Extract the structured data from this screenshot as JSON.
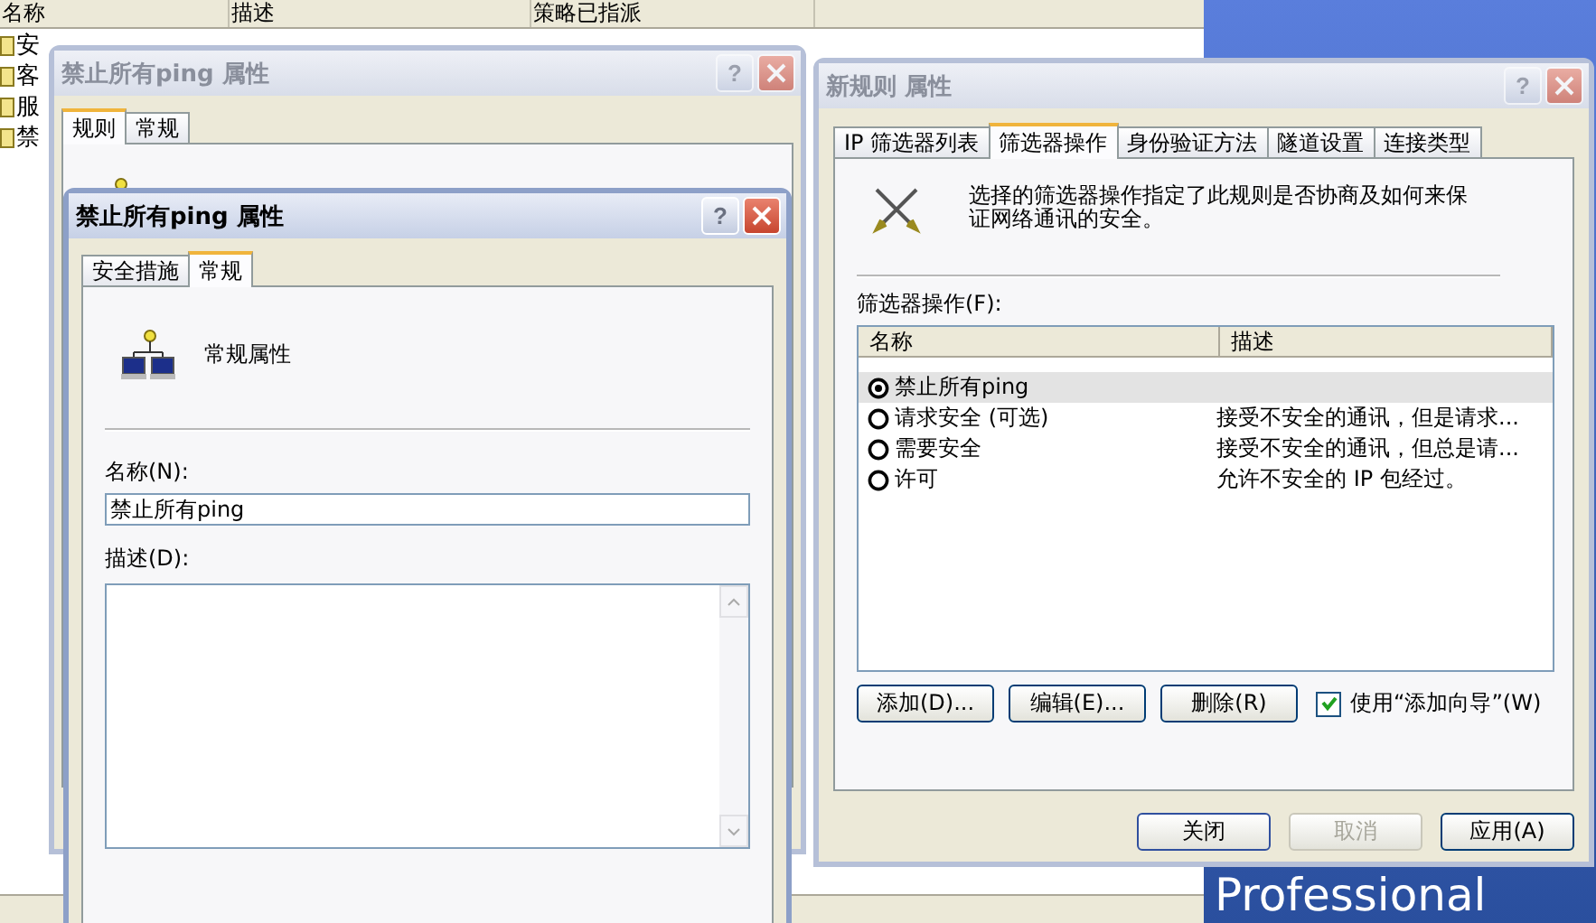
{
  "list_window": {
    "columns": [
      "名称",
      "描述",
      "策略已指派"
    ],
    "rows": [
      "安",
      "客",
      "服",
      "禁"
    ]
  },
  "desktop": {
    "wallpaper_text": "Professional"
  },
  "back_dialog": {
    "title": "禁止所有ping 属性",
    "active": false,
    "help": "?",
    "tabs": [
      {
        "label": "规则",
        "selected": true
      },
      {
        "label": "常规",
        "selected": false
      }
    ]
  },
  "general_dialog": {
    "title": "禁止所有ping 属性",
    "active": true,
    "help": "?",
    "tabs": [
      {
        "label": "安全措施",
        "selected": false
      },
      {
        "label": "常规",
        "selected": true
      }
    ],
    "heading": "常规属性",
    "name_label": "名称(N):",
    "name_value": "禁止所有ping",
    "description_label": "描述(D):"
  },
  "rule_dialog": {
    "title": "新规则 属性",
    "active": false,
    "help": "?",
    "tabs": [
      {
        "label": "IP 筛选器列表",
        "selected": false
      },
      {
        "label": "筛选器操作",
        "selected": true
      },
      {
        "label": "身份验证方法",
        "selected": false
      },
      {
        "label": "隧道设置",
        "selected": false
      },
      {
        "label": "连接类型",
        "selected": false
      }
    ],
    "intro": "选择的筛选器操作指定了此规则是否协商及如何来保证网络通讯的安全。",
    "list_label": "筛选器操作(F):",
    "columns": [
      "名称",
      "描述"
    ],
    "actions": [
      {
        "name": "禁止所有ping",
        "selected": true
      },
      {
        "name": "请求安全 (可选)",
        "description": "接受不安全的通讯，但是请求...",
        "selected": false
      },
      {
        "name": "需要安全",
        "description": "接受不安全的通讯，但总是请...",
        "selected": false
      },
      {
        "name": "许可",
        "description": "允许不安全的 IP 包经过。",
        "selected": false
      }
    ],
    "list_buttons": [
      {
        "label": "添加(D)..."
      },
      {
        "label": "编辑(E)..."
      },
      {
        "label": "删除(R)"
      }
    ],
    "wizard": {
      "label": "使用“添加向导”(W)",
      "checked": true
    },
    "footer_buttons": [
      {
        "label": "关闭",
        "disabled": false,
        "default": true
      },
      {
        "label": "取消",
        "disabled": true,
        "default": false
      },
      {
        "label": "应用(A)",
        "disabled": false,
        "default": false
      }
    ]
  }
}
